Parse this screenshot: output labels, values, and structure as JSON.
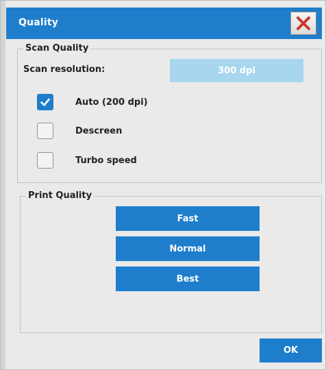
{
  "dialog": {
    "title": "Quality",
    "close_icon": "close-x-icon"
  },
  "scan_quality": {
    "legend": "Scan Quality",
    "resolution_label": "Scan resolution:",
    "resolution_value": "300 dpi",
    "options": [
      {
        "label": "Auto (200 dpi)",
        "checked": true
      },
      {
        "label": "Descreen",
        "checked": false
      },
      {
        "label": "Turbo speed",
        "checked": false
      }
    ]
  },
  "print_quality": {
    "legend": "Print Quality",
    "buttons": [
      "Fast",
      "Normal",
      "Best"
    ]
  },
  "footer": {
    "ok_label": "OK"
  },
  "colors": {
    "accent": "#1f7ecb",
    "disabled_field": "#a8d6ef",
    "close_icon": "#c8372d"
  }
}
